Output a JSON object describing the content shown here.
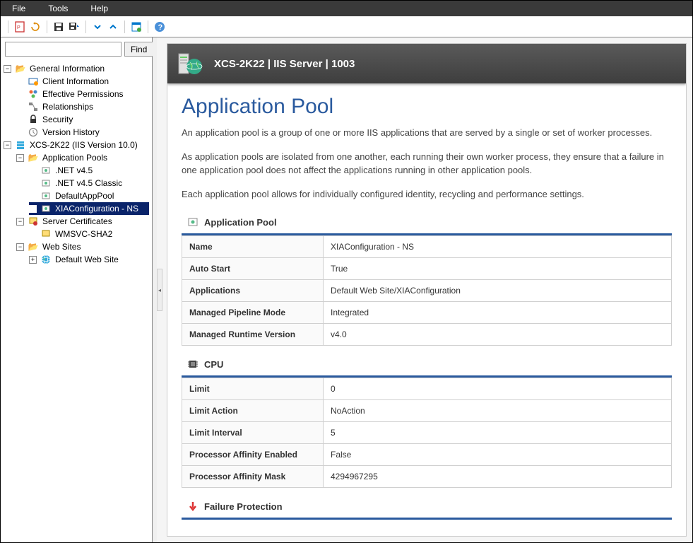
{
  "menu": {
    "file": "File",
    "tools": "Tools",
    "help": "Help"
  },
  "search": {
    "placeholder": "",
    "find": "Find"
  },
  "tree": {
    "general": "General Information",
    "client": "Client Information",
    "permissions": "Effective Permissions",
    "relationships": "Relationships",
    "security": "Security",
    "version": "Version History",
    "server": "XCS-2K22 (IIS Version 10.0)",
    "apppools": "Application Pools",
    "net45": ".NET v4.5",
    "net45c": ".NET v4.5 Classic",
    "defaultpool": "DefaultAppPool",
    "xiaconfig": "XIAConfiguration - NS",
    "certs": "Server Certificates",
    "wmsvc": "WMSVC-SHA2",
    "websites": "Web Sites",
    "defaultsite": "Default Web Site"
  },
  "banner": {
    "title": "XCS-2K22 | IIS Server | 1003"
  },
  "doc": {
    "title": "Application Pool",
    "p1": "An application pool is a group of one or more IIS applications that are served by a single or set of worker processes.",
    "p2": "As application pools are isolated from one another, each running their own worker process, they ensure that a failure in one application pool does not affect the applications running in other application pools.",
    "p3": "Each application pool allows for individually configured identity, recycling and performance settings."
  },
  "sec1": {
    "header": "Application Pool",
    "rows": [
      {
        "k": "Name",
        "v": "XIAConfiguration - NS"
      },
      {
        "k": "Auto Start",
        "v": "True"
      },
      {
        "k": "Applications",
        "v": "Default Web Site/XIAConfiguration"
      },
      {
        "k": "Managed Pipeline Mode",
        "v": "Integrated"
      },
      {
        "k": "Managed Runtime Version",
        "v": "v4.0"
      }
    ]
  },
  "sec2": {
    "header": "CPU",
    "rows": [
      {
        "k": "Limit",
        "v": "0"
      },
      {
        "k": "Limit Action",
        "v": "NoAction"
      },
      {
        "k": "Limit Interval",
        "v": "5"
      },
      {
        "k": "Processor Affinity Enabled",
        "v": "False"
      },
      {
        "k": "Processor Affinity Mask",
        "v": "4294967295"
      }
    ]
  },
  "sec3": {
    "header": "Failure Protection"
  }
}
